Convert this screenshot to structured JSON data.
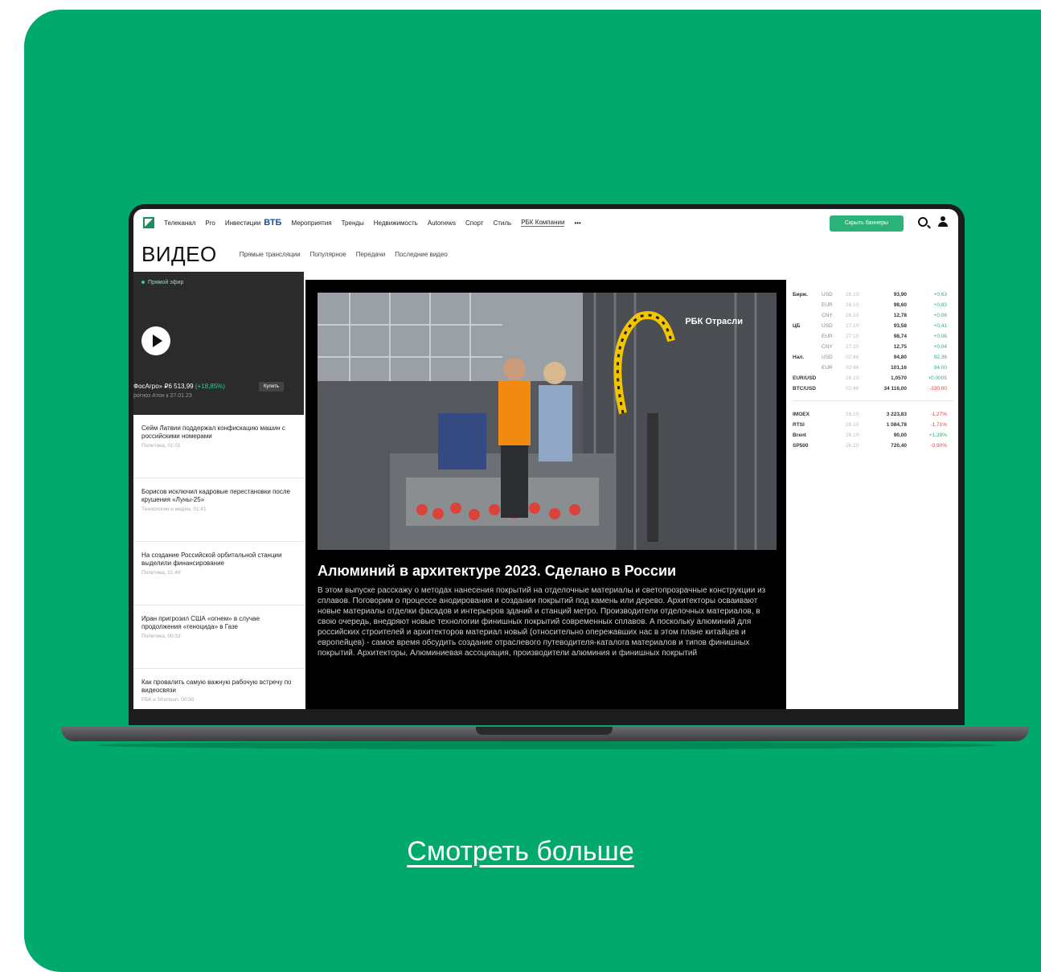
{
  "cta": {
    "label": "Смотреть больше"
  },
  "topnav": {
    "items": [
      "Телеканал",
      "Pro",
      "Инвестиции",
      "ВТБ",
      "Мероприятия",
      "Тренды",
      "Недвижимость",
      "Autonews",
      "Спорт",
      "Стиль",
      "РБК Компании",
      "•••"
    ],
    "hide_banners": "Скрыть баннеры"
  },
  "subnav": {
    "title": "ВИДЕО",
    "items": [
      "Прямые трансляции",
      "Популярное",
      "Передачи",
      "Последние видео"
    ]
  },
  "live": {
    "label": "Прямой эфир",
    "ticker": "ФосАгро» ₽6 513,99",
    "ticker_change": "(+18,85%)",
    "buy": "Купить",
    "ticker_sub": "рогноз Атон к 27.01.23"
  },
  "news": [
    {
      "title": "Сейм Латвии поддержал конфискацию машин с российскими номерами",
      "meta": "Политика, 01:02"
    },
    {
      "title": "Борисов исключил кадровые перестановки после крушения «Луны-25»",
      "meta": "Технологии и медиа, 01:41"
    },
    {
      "title": "На создание Российской орбитальной станции выделили финансирование",
      "meta": "Политика, 01:49"
    },
    {
      "title": "Иран пригрозил США «огнем» в случае продолжения «геноцида» в Газе",
      "meta": "Политика, 00:53"
    },
    {
      "title": "Как провалить самую важную рабочую встречу по видеосвязи",
      "meta": "РБК и Shortson, 00:50"
    }
  ],
  "video": {
    "brand": "РБК Отрасли",
    "title": "Алюминий в архитектуре 2023. Сделано в России",
    "description": "В этом выпуске расскажу о методах нанесения покрытий на отделочные материалы и светопрозрачные конструкции из сплавов. Поговорим о процессе анодирования и создании покрытий под камень или дерево. Архитекторы осваивают новые материалы отделки фасадов и интерьеров зданий и станций метро. Производители отделочных материалов, в свою очередь, внедряют новые технологии финишных покрытий современных сплавов. А поскольку алюминий для российских строителей и архитекторов материал новый (относительно опережавших нас в этом плане китайцев и европейцев) - самое время обсудить создание отраслевого путеводителя-каталога материалов и типов финишных покрытий. Архитекторы, Алюминиевая ассоциация, производители алюминия и финишных покрытий"
  },
  "rates": [
    {
      "g": "Бирж.",
      "cur": "USD",
      "d": "26.10",
      "v": "93,90",
      "c": "+0,63",
      "neg": false
    },
    {
      "g": "",
      "cur": "EUR",
      "d": "26.10",
      "v": "98,60",
      "c": "+0,83",
      "neg": false
    },
    {
      "g": "",
      "cur": "CNY",
      "d": "26.10",
      "v": "12,78",
      "c": "+0,06",
      "neg": false
    },
    {
      "g": "ЦБ",
      "cur": "USD",
      "d": "27.10",
      "v": "93,58",
      "c": "+0,41",
      "neg": false
    },
    {
      "g": "",
      "cur": "EUR",
      "d": "27.10",
      "v": "98,74",
      "c": "+0,06",
      "neg": false
    },
    {
      "g": "",
      "cur": "CNY",
      "d": "27.10",
      "v": "12,75",
      "c": "+0,04",
      "neg": false
    },
    {
      "g": "Нал.",
      "cur": "USD",
      "d": "02:46",
      "v": "94,80",
      "c": "92,36",
      "neg": false
    },
    {
      "g": "",
      "cur": "EUR",
      "d": "02:46",
      "v": "101,16",
      "c": "94.00",
      "neg": false
    },
    {
      "g": "EUR/USD",
      "cur": "",
      "d": "26.10",
      "v": "1,0570",
      "c": "+0,0005",
      "neg": false
    },
    {
      "g": "BTC/USD",
      "cur": "",
      "d": "02:46",
      "v": "34 116,00",
      "c": "-330,00",
      "neg": true
    }
  ],
  "indices": [
    {
      "g": "IMOEX",
      "d": "26.10",
      "v": "3 223,83",
      "c": "-1,27%",
      "neg": true
    },
    {
      "g": "RTSI",
      "d": "26.10",
      "v": "1 084,78",
      "c": "-1,71%",
      "neg": true
    },
    {
      "g": "Brent",
      "d": "26.10",
      "v": "90,00",
      "c": "+1,39%",
      "neg": false
    },
    {
      "g": "SP500",
      "d": "26.10",
      "v": "720,40",
      "c": "-0,90%",
      "neg": true
    }
  ]
}
